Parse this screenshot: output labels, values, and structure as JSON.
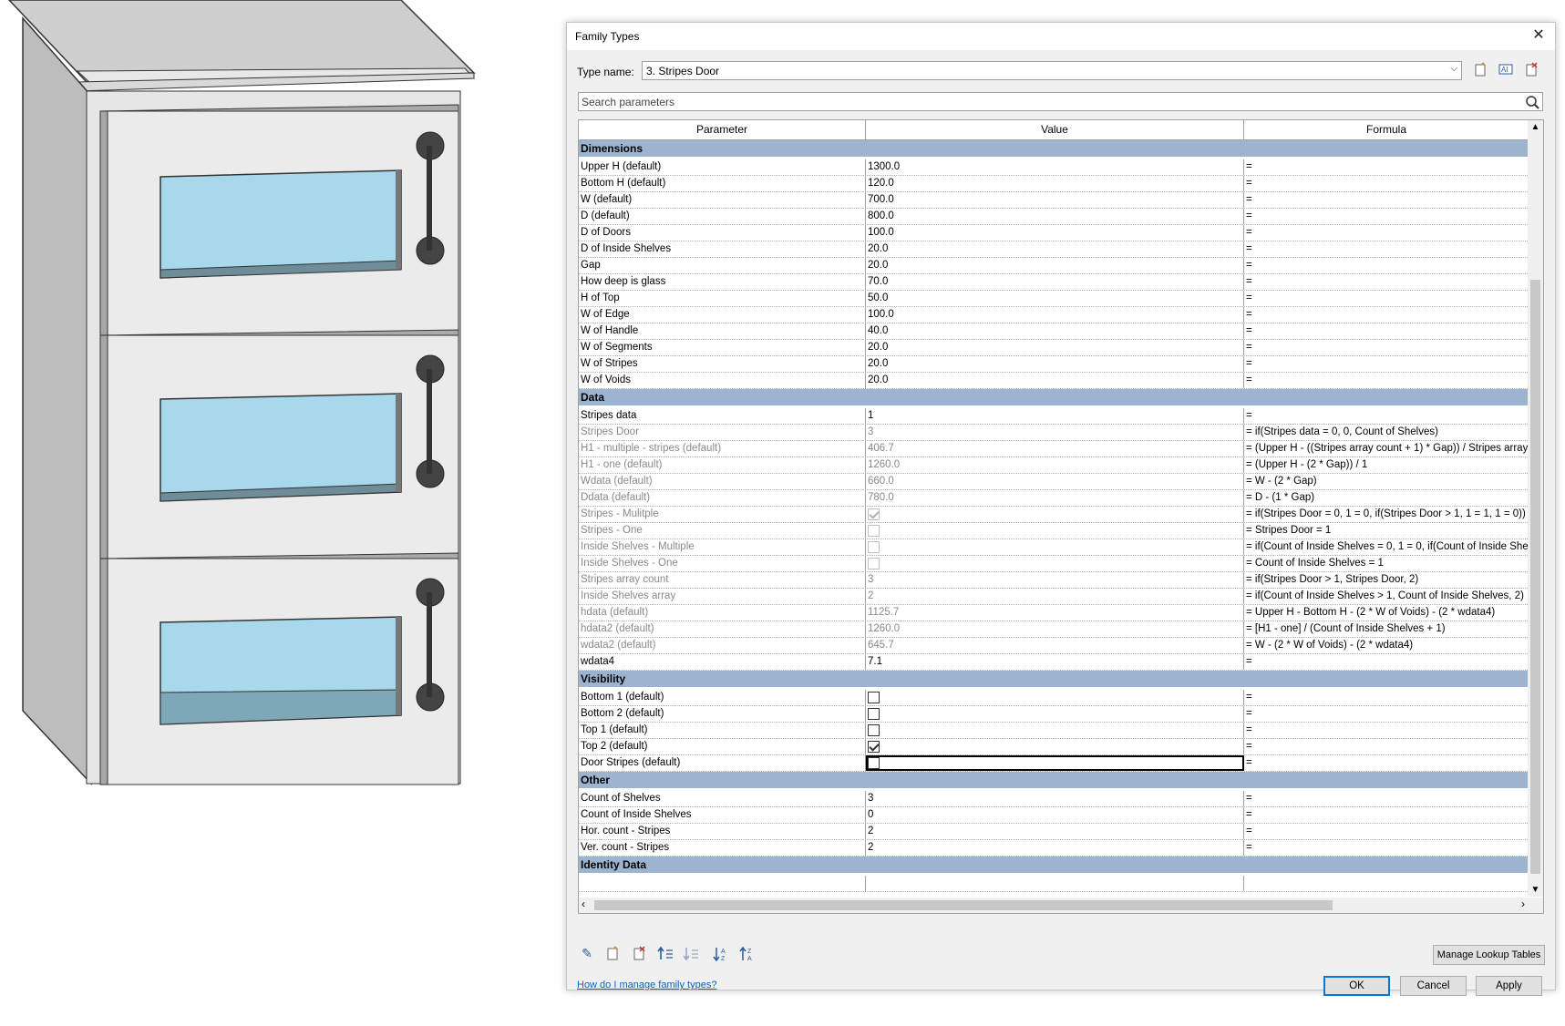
{
  "window": {
    "title": "Family Types"
  },
  "type_name": {
    "label": "Type name:",
    "value": "3. Stripes Door"
  },
  "search": {
    "placeholder": "Search parameters"
  },
  "columns": [
    "Parameter",
    "Value",
    "Formula"
  ],
  "groups": [
    {
      "name": "Dimensions",
      "rows": [
        {
          "p": "Upper H (default)",
          "v": "1300.0",
          "f": "="
        },
        {
          "p": "Bottom H (default)",
          "v": "120.0",
          "f": "="
        },
        {
          "p": "W (default)",
          "v": "700.0",
          "f": "="
        },
        {
          "p": "D (default)",
          "v": "800.0",
          "f": "="
        },
        {
          "p": "D of Doors",
          "v": "100.0",
          "f": "="
        },
        {
          "p": "D of Inside Shelves",
          "v": "20.0",
          "f": "="
        },
        {
          "p": "Gap",
          "v": "20.0",
          "f": "="
        },
        {
          "p": "How deep is glass",
          "v": "70.0",
          "f": "="
        },
        {
          "p": "H of Top",
          "v": "50.0",
          "f": "="
        },
        {
          "p": "W of Edge",
          "v": "100.0",
          "f": "="
        },
        {
          "p": "W of Handle",
          "v": "40.0",
          "f": "="
        },
        {
          "p": "W of Segments",
          "v": "20.0",
          "f": "="
        },
        {
          "p": "W of Stripes",
          "v": "20.0",
          "f": "="
        },
        {
          "p": "W of Voids",
          "v": "20.0",
          "f": "="
        }
      ]
    },
    {
      "name": "Data",
      "rows": [
        {
          "p": "Stripes data",
          "v": "1",
          "f": "="
        },
        {
          "p": "Stripes Door",
          "v": "3",
          "f": "= if(Stripes data = 0, 0, Count of Shelves)",
          "ro": true
        },
        {
          "p": "H1 - multiple - stripes (default)",
          "v": "406.7",
          "f": "= (Upper H - ((Stripes array count + 1) * Gap)) / Stripes array",
          "ro": true
        },
        {
          "p": "H1 - one (default)",
          "v": "1260.0",
          "f": "= (Upper H - (2 * Gap)) / 1",
          "ro": true
        },
        {
          "p": "Wdata (default)",
          "v": "660.0",
          "f": "= W - (2 * Gap)",
          "ro": true
        },
        {
          "p": "Ddata (default)",
          "v": "780.0",
          "f": "= D - (1 * Gap)",
          "ro": true
        },
        {
          "p": "Stripes - Mulitple",
          "cb": true,
          "checked": true,
          "f": "= if(Stripes Door = 0, 1 = 0, if(Stripes Door > 1, 1 = 1, 1 = 0))",
          "ro": true
        },
        {
          "p": "Stripes - One",
          "cb": true,
          "checked": false,
          "f": "= Stripes Door = 1",
          "ro": true
        },
        {
          "p": "Inside Shelves - Multiple",
          "cb": true,
          "checked": false,
          "f": "= if(Count of Inside Shelves = 0, 1 = 0, if(Count of Inside She",
          "ro": true
        },
        {
          "p": "Inside Shelves - One",
          "cb": true,
          "checked": false,
          "f": "= Count of Inside Shelves = 1",
          "ro": true
        },
        {
          "p": "Stripes array count",
          "v": "3",
          "f": "= if(Stripes Door > 1, Stripes Door, 2)",
          "ro": true
        },
        {
          "p": "Inside Shelves array",
          "v": "2",
          "f": "= if(Count of Inside Shelves > 1, Count of Inside Shelves, 2)",
          "ro": true
        },
        {
          "p": "hdata (default)",
          "v": "1125.7",
          "f": "= Upper H - Bottom H - (2 * W of Voids) - (2 * wdata4)",
          "ro": true
        },
        {
          "p": "hdata2 (default)",
          "v": "1260.0",
          "f": "= [H1 - one] / (Count of Inside Shelves + 1)",
          "ro": true
        },
        {
          "p": "wdata2 (default)",
          "v": "645.7",
          "f": "= W - (2 * W of Voids) - (2 * wdata4)",
          "ro": true
        },
        {
          "p": "wdata4",
          "v": "7.1",
          "f": "="
        }
      ]
    },
    {
      "name": "Visibility",
      "rows": [
        {
          "p": "Bottom 1 (default)",
          "cb": true,
          "checked": false,
          "f": "="
        },
        {
          "p": "Bottom 2 (default)",
          "cb": true,
          "checked": false,
          "f": "="
        },
        {
          "p": "Top 1 (default)",
          "cb": true,
          "checked": false,
          "f": "="
        },
        {
          "p": "Top 2 (default)",
          "cb": true,
          "checked": true,
          "f": "="
        },
        {
          "p": "Door Stripes (default)",
          "cb": true,
          "checked": false,
          "f": "=",
          "sel": true
        }
      ]
    },
    {
      "name": "Other",
      "rows": [
        {
          "p": "Count of Shelves",
          "v": "3",
          "f": "="
        },
        {
          "p": "Count of Inside Shelves",
          "v": "0",
          "f": "="
        },
        {
          "p": "Hor. count - Stripes",
          "v": "2",
          "f": "="
        },
        {
          "p": "Ver. count - Stripes",
          "v": "2",
          "f": "="
        }
      ]
    },
    {
      "name": "Identity Data",
      "rows": [
        {
          "p": "",
          "v": "",
          "f": ""
        }
      ]
    }
  ],
  "buttons": {
    "manage_lookup": "Manage Lookup Tables",
    "help_link": "How do I manage family types?",
    "ok": "OK",
    "cancel": "Cancel",
    "apply": "Apply"
  },
  "colors": {
    "group_header": "#9cb4d0",
    "glass": "#a8d8ec",
    "accent": "#0078d7"
  }
}
